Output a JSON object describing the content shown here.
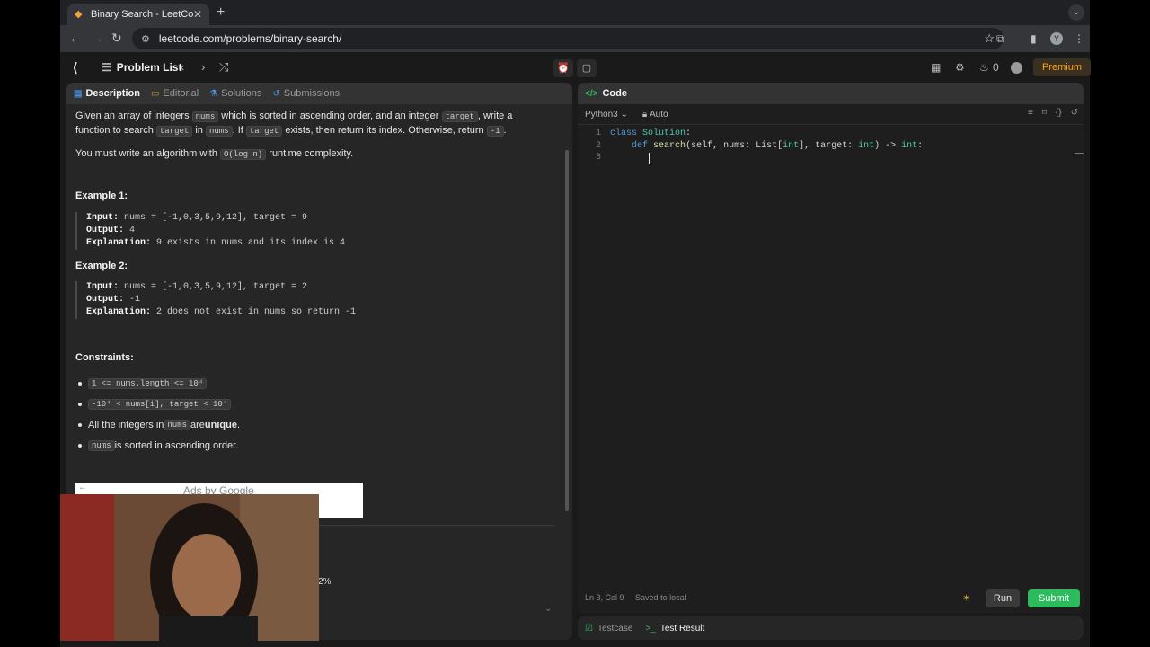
{
  "browser": {
    "tab_title": "Binary Search - LeetCode",
    "url": "leetcode.com/problems/binary-search/",
    "profile_initial": "Y"
  },
  "header": {
    "problem_list": "Problem List",
    "fire_count": "0",
    "premium": "Premium"
  },
  "left_tabs": [
    "Description",
    "Editorial",
    "Solutions",
    "Submissions"
  ],
  "description": {
    "p1_a": "Given an array of integers ",
    "p1_code1": "nums",
    "p1_b": " which is sorted in ascending order, and an integer ",
    "p1_code2": "target",
    "p1_c": ", write a function to search ",
    "p1_code3": "target",
    "p1_d": " in ",
    "p1_code4": "nums",
    "p1_e": ". If ",
    "p1_code5": "target",
    "p1_f": " exists, then return its index. Otherwise, return ",
    "p1_code6": "-1",
    "p1_g": ".",
    "p2_a": "You must write an algorithm with ",
    "p2_code": "O(log n)",
    "p2_b": " runtime complexity."
  },
  "examples": [
    {
      "title": "Example 1:",
      "input_label": "Input:",
      "input": " nums = [-1,0,3,5,9,12], target = 9",
      "output_label": "Output:",
      "output": " 4",
      "explanation_label": "Explanation:",
      "explanation": " 9 exists in nums and its index is 4"
    },
    {
      "title": "Example 2:",
      "input_label": "Input:",
      "input": " nums = [-1,0,3,5,9,12], target = 2",
      "output_label": "Output:",
      "output": " -1",
      "explanation_label": "Explanation:",
      "explanation": " 2 does not exist in nums so return -1"
    }
  ],
  "constraints": {
    "title": "Constraints:",
    "c1": "1 <= nums.length <= 10⁴",
    "c2": "-10⁴ < nums[i], target < 10⁴",
    "c3_a": "All the integers in ",
    "c3_code": "nums",
    "c3_b": " are ",
    "c3_bold": "unique",
    "c3_c": ".",
    "c4_code": "nums",
    "c4_b": " is sorted in ascending order."
  },
  "ads": "Ads by Google",
  "partial_stat": "2%",
  "code_panel": {
    "tab": "Code",
    "language": "Python3",
    "mode": "Auto",
    "lines": [
      {
        "num": "1",
        "text": "class Solution:"
      },
      {
        "num": "2",
        "text": "    def search(self, nums: List[int], target: int) -> int:"
      },
      {
        "num": "3",
        "text": ""
      }
    ],
    "status_pos": "Ln 3, Col 9",
    "status_saved": "Saved to local",
    "run": "Run",
    "submit": "Submit"
  },
  "bottom_tabs": [
    "Testcase",
    "Test Result"
  ]
}
